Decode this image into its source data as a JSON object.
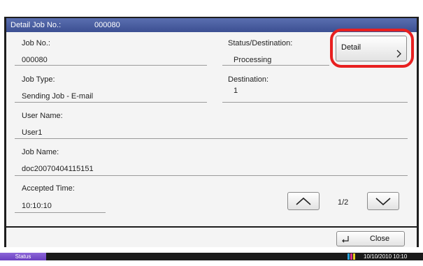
{
  "title_bar": {
    "label": "Detail Job No.:",
    "value": "000080"
  },
  "fields": {
    "job_no": {
      "label": "Job No.:",
      "value": "000080"
    },
    "status_destination": {
      "label": "Status/Destination:",
      "value": "Processing"
    },
    "job_type": {
      "label": "Job Type:",
      "value": "Sending Job - E-mail"
    },
    "destination": {
      "label": "Destination:",
      "value": "1"
    },
    "user_name": {
      "label": "User Name:",
      "value": "User1"
    },
    "job_name": {
      "label": "Job Name:",
      "value": "doc20070404115151"
    },
    "accepted_time": {
      "label": "Accepted Time:",
      "value": "10:10:10"
    }
  },
  "buttons": {
    "detail": "Detail",
    "close": "Close"
  },
  "pager": {
    "page": "1/2"
  },
  "status_bar": {
    "status_label": "Status",
    "datetime": "10/10/2010  10:10"
  },
  "icons": {
    "detail_arrow": "chevron-right-icon",
    "page_up": "chevron-up-icon",
    "page_down": "chevron-down-icon",
    "close": "return-icon",
    "toner": "toner-status-icon"
  },
  "colors": {
    "title_bar": "#4a5fa3",
    "highlight_ring": "#e82020",
    "status_tab": "#7a4fd0"
  }
}
